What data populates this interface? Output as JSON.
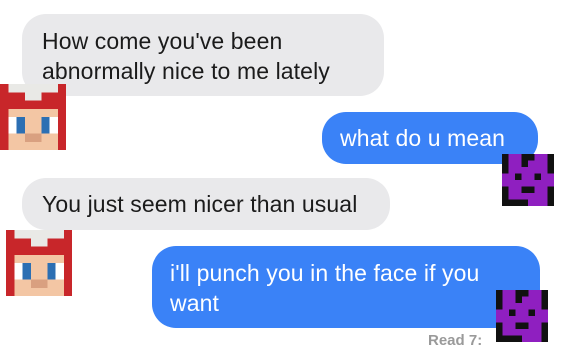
{
  "messages": [
    {
      "sender": "them",
      "text": "How come you've been abnormally nice to me lately"
    },
    {
      "sender": "me",
      "text": "what do u mean"
    },
    {
      "sender": "them",
      "text": "You just seem nicer than usual"
    },
    {
      "sender": "me",
      "text": "i'll punch you in the face if you want"
    }
  ],
  "receipt": {
    "text": "Read 7:"
  },
  "colors": {
    "incoming_bubble": "#e9e9eb",
    "outgoing_bubble": "#3a82f7",
    "avatar_purple": "#8f1fc0"
  },
  "icons": {
    "incoming_avatar": "pixel-girl-avatar-icon",
    "outgoing_avatar": "pixel-purple-avatar-icon"
  }
}
